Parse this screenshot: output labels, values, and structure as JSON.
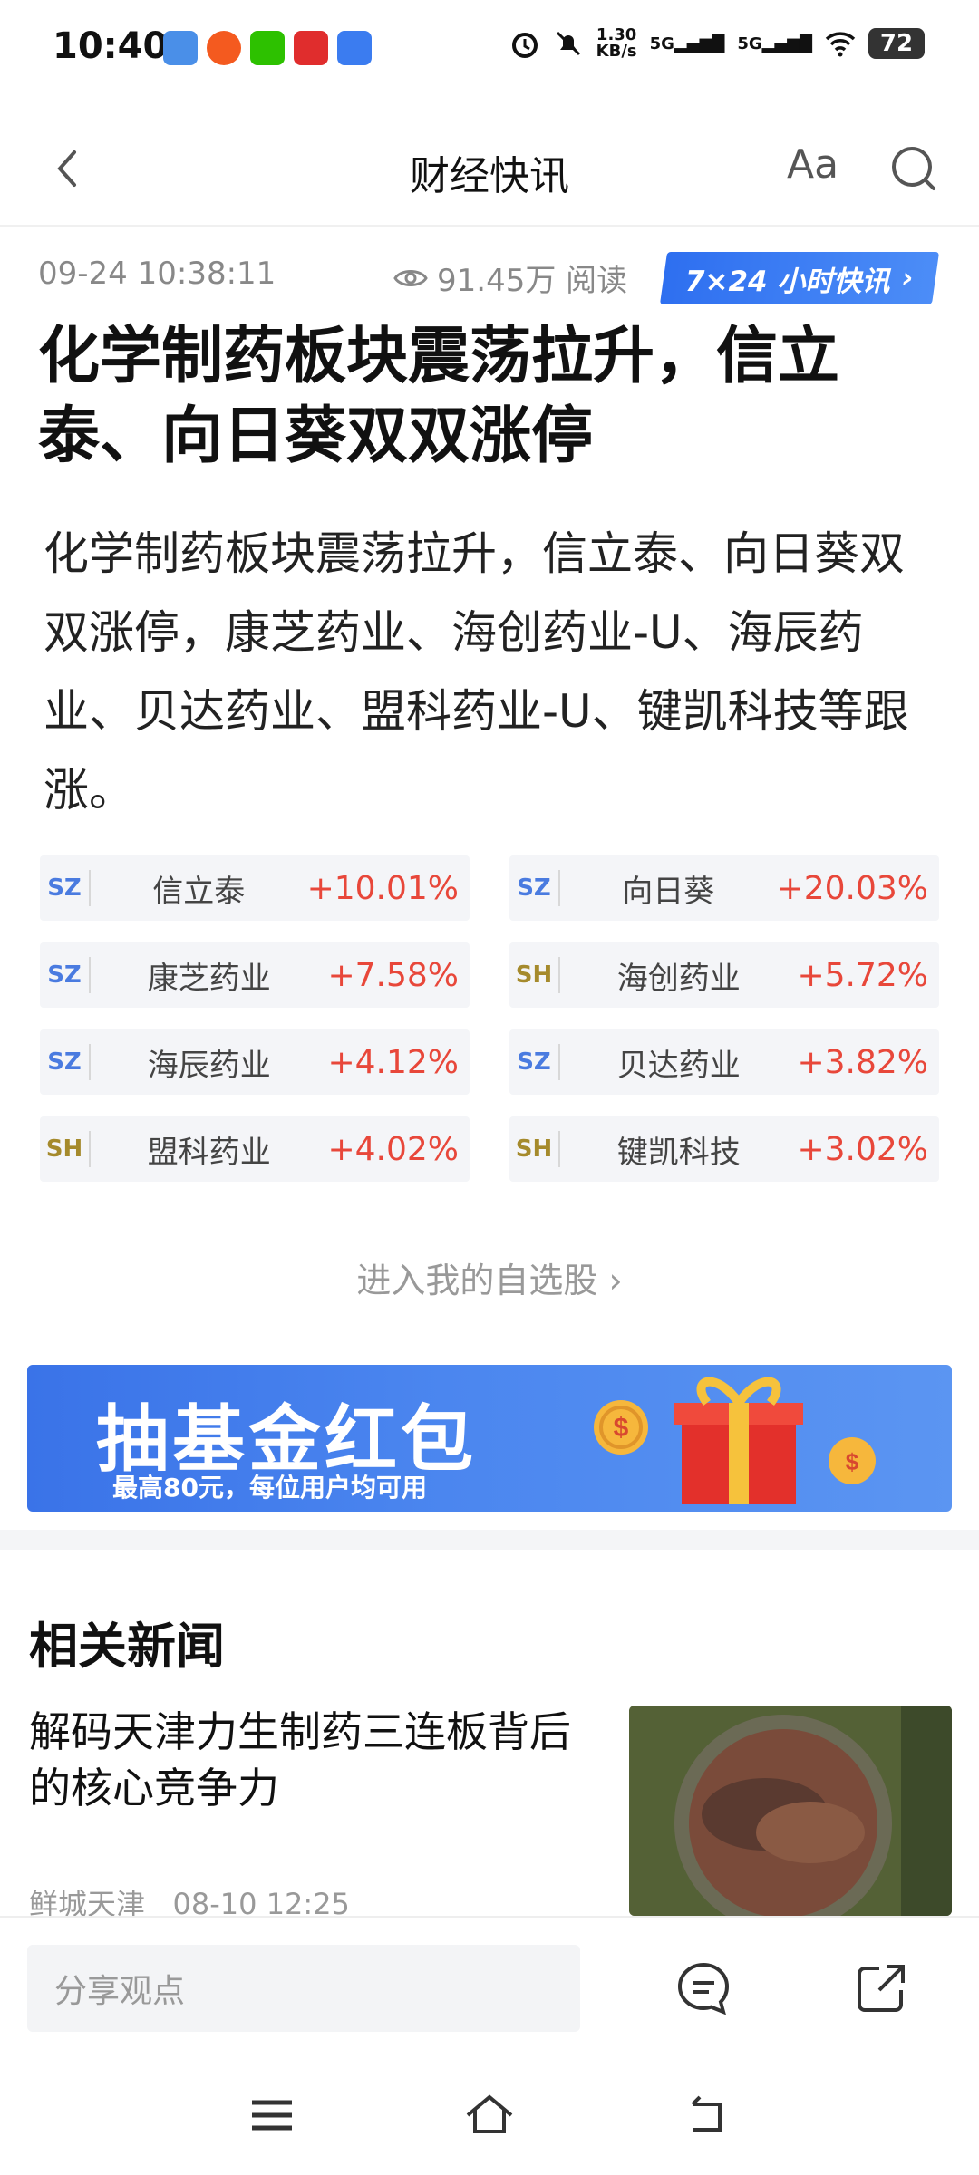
{
  "status_bar": {
    "time": "10:40",
    "net_speed_value": "1.30",
    "net_speed_unit": "KB/s",
    "signal1": "5G",
    "signal2": "5G",
    "battery": "72"
  },
  "header": {
    "title": "财经快讯",
    "font_button": "Aa"
  },
  "article": {
    "timestamp": "09-24 10:38:11",
    "views": "91.45万 阅读",
    "badge_label": "7×24 小时快讯",
    "headline": "化学制药板块震荡拉升，信立泰、向日葵双双涨停",
    "summary": "化学制药板块震荡拉升，信立泰、向日葵双双涨停，康芝药业、海创药业-U、海辰药业、贝达药业、盟科药业-U、键凯科技等跟涨。"
  },
  "stocks": [
    {
      "market": "SZ",
      "name": "信立泰",
      "change": "+10.01%"
    },
    {
      "market": "SZ",
      "name": "向日葵",
      "change": "+20.03%"
    },
    {
      "market": "SZ",
      "name": "康芝药业",
      "change": "+7.58%"
    },
    {
      "market": "SH",
      "name": "海创药业",
      "change": "+5.72%"
    },
    {
      "market": "SZ",
      "name": "海辰药业",
      "change": "+4.12%"
    },
    {
      "market": "SZ",
      "name": "贝达药业",
      "change": "+3.82%"
    },
    {
      "market": "SH",
      "name": "盟科药业",
      "change": "+4.02%"
    },
    {
      "market": "SH",
      "name": "键凯科技",
      "change": "+3.02%"
    }
  ],
  "watchlist_link": "进入我的自选股",
  "banner": {
    "title": "抽基金红包",
    "subtitle": "最高80元，每位用户均可用"
  },
  "related": {
    "section_title": "相关新闻",
    "items": [
      {
        "title": "解码天津力生制药三连板背后的核心竞争力",
        "source": "鲜城天津",
        "time": "08-10 12:25"
      }
    ]
  },
  "bottom_bar": {
    "comment_placeholder": "分享观点"
  },
  "colors": {
    "accent_blue": "#2e6ff0",
    "up_red": "#e8473a",
    "sz_blue": "#4a7be0",
    "sh_gold": "#a58a2c"
  }
}
